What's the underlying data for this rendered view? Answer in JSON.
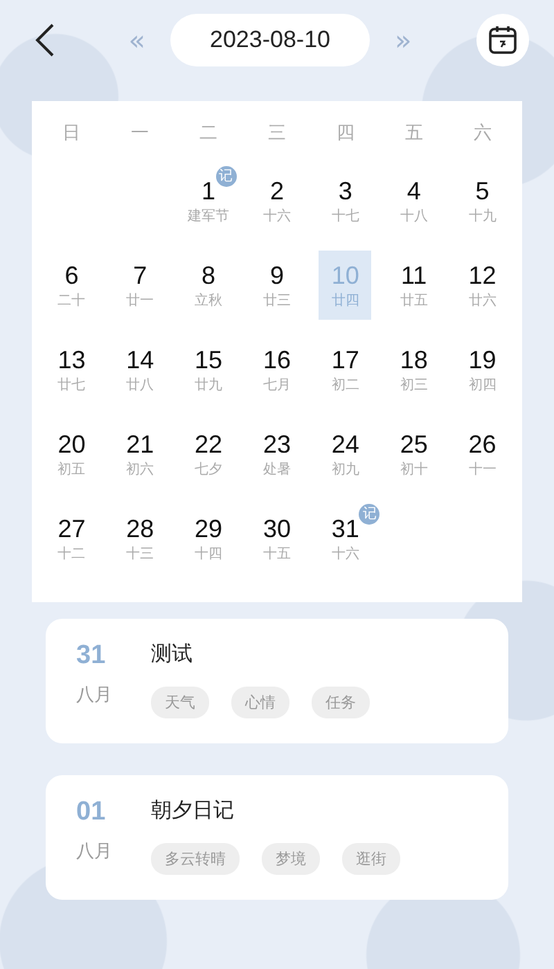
{
  "header": {
    "date": "2023-08-10",
    "prev": "«",
    "next": "»"
  },
  "weekdays": [
    "日",
    "一",
    "二",
    "三",
    "四",
    "五",
    "六"
  ],
  "weeks": [
    [
      {
        "kind": "blank"
      },
      {
        "kind": "blank"
      },
      {
        "kind": "day",
        "day": "1",
        "lunar": "建军节",
        "selected": false,
        "note": true
      },
      {
        "kind": "day",
        "day": "2",
        "lunar": "十六",
        "selected": false,
        "note": false
      },
      {
        "kind": "day",
        "day": "3",
        "lunar": "十七",
        "selected": false,
        "note": false
      },
      {
        "kind": "day",
        "day": "4",
        "lunar": "十八",
        "selected": false,
        "note": false
      },
      {
        "kind": "day",
        "day": "5",
        "lunar": "十九",
        "selected": false,
        "note": false
      }
    ],
    [
      {
        "kind": "day",
        "day": "6",
        "lunar": "二十",
        "selected": false,
        "note": false
      },
      {
        "kind": "day",
        "day": "7",
        "lunar": "廿一",
        "selected": false,
        "note": false
      },
      {
        "kind": "day",
        "day": "8",
        "lunar": "立秋",
        "selected": false,
        "note": false
      },
      {
        "kind": "day",
        "day": "9",
        "lunar": "廿三",
        "selected": false,
        "note": false
      },
      {
        "kind": "day",
        "day": "10",
        "lunar": "廿四",
        "selected": true,
        "note": false
      },
      {
        "kind": "day",
        "day": "11",
        "lunar": "廿五",
        "selected": false,
        "note": false
      },
      {
        "kind": "day",
        "day": "12",
        "lunar": "廿六",
        "selected": false,
        "note": false
      }
    ],
    [
      {
        "kind": "day",
        "day": "13",
        "lunar": "廿七",
        "selected": false,
        "note": false
      },
      {
        "kind": "day",
        "day": "14",
        "lunar": "廿八",
        "selected": false,
        "note": false
      },
      {
        "kind": "day",
        "day": "15",
        "lunar": "廿九",
        "selected": false,
        "note": false
      },
      {
        "kind": "day",
        "day": "16",
        "lunar": "七月",
        "selected": false,
        "note": false
      },
      {
        "kind": "day",
        "day": "17",
        "lunar": "初二",
        "selected": false,
        "note": false
      },
      {
        "kind": "day",
        "day": "18",
        "lunar": "初三",
        "selected": false,
        "note": false
      },
      {
        "kind": "day",
        "day": "19",
        "lunar": "初四",
        "selected": false,
        "note": false
      }
    ],
    [
      {
        "kind": "day",
        "day": "20",
        "lunar": "初五",
        "selected": false,
        "note": false
      },
      {
        "kind": "day",
        "day": "21",
        "lunar": "初六",
        "selected": false,
        "note": false
      },
      {
        "kind": "day",
        "day": "22",
        "lunar": "七夕",
        "selected": false,
        "note": false
      },
      {
        "kind": "day",
        "day": "23",
        "lunar": "处暑",
        "selected": false,
        "note": false
      },
      {
        "kind": "day",
        "day": "24",
        "lunar": "初九",
        "selected": false,
        "note": false
      },
      {
        "kind": "day",
        "day": "25",
        "lunar": "初十",
        "selected": false,
        "note": false
      },
      {
        "kind": "day",
        "day": "26",
        "lunar": "十一",
        "selected": false,
        "note": false
      }
    ],
    [
      {
        "kind": "day",
        "day": "27",
        "lunar": "十二",
        "selected": false,
        "note": false
      },
      {
        "kind": "day",
        "day": "28",
        "lunar": "十三",
        "selected": false,
        "note": false
      },
      {
        "kind": "day",
        "day": "29",
        "lunar": "十四",
        "selected": false,
        "note": false
      },
      {
        "kind": "day",
        "day": "30",
        "lunar": "十五",
        "selected": false,
        "note": false
      },
      {
        "kind": "day",
        "day": "31",
        "lunar": "十六",
        "selected": false,
        "note": true,
        "note_label": "记"
      },
      {
        "kind": "blank"
      },
      {
        "kind": "blank"
      }
    ]
  ],
  "note_label": "记",
  "entries": [
    {
      "day": "31",
      "month": "八月",
      "title": "测试",
      "tags": [
        "天气",
        "心情",
        "任务"
      ]
    },
    {
      "day": "01",
      "month": "八月",
      "title": "朝夕日记",
      "tags": [
        "多云转晴",
        "梦境",
        "逛街"
      ]
    }
  ]
}
